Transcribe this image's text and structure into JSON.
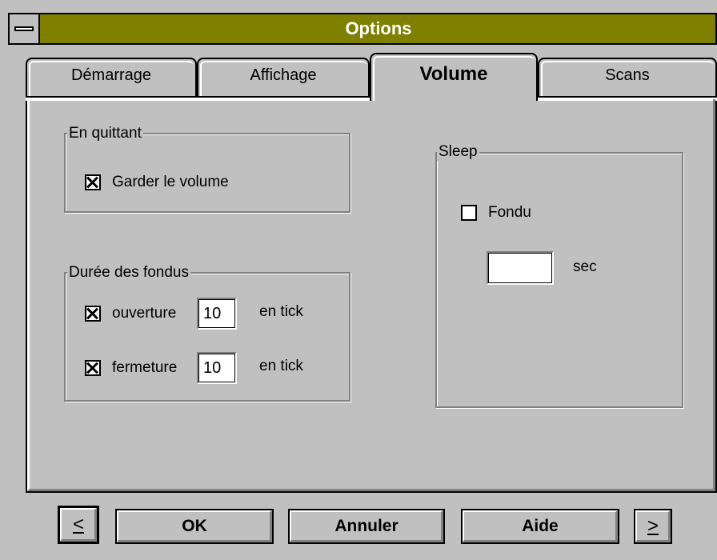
{
  "window": {
    "title": "Options"
  },
  "tabs": [
    {
      "label": "Démarrage",
      "active": false
    },
    {
      "label": "Affichage",
      "active": false
    },
    {
      "label": "Volume",
      "active": true
    },
    {
      "label": "Scans",
      "active": false
    }
  ],
  "quit_group": {
    "title": "En quittant",
    "keep_volume": {
      "label": "Garder le volume",
      "checked": true
    }
  },
  "fade_group": {
    "title": "Durée des fondus",
    "opening": {
      "label": "ouverture",
      "checked": true,
      "value": "10",
      "unit": "en tick"
    },
    "closing": {
      "label": "fermeture",
      "checked": true,
      "value": "10",
      "unit": "en tick"
    }
  },
  "sleep_group": {
    "title": "Sleep",
    "fade": {
      "label": "Fondu",
      "checked": false
    },
    "duration": {
      "value": "",
      "unit": "sec"
    }
  },
  "buttons": {
    "prev": "<",
    "ok": "OK",
    "cancel": "Annuler",
    "help": "Aide",
    "next": ">"
  },
  "colors": {
    "face": "#c0c0c0",
    "title_bar": "#808000",
    "title_text": "#ffffff"
  }
}
